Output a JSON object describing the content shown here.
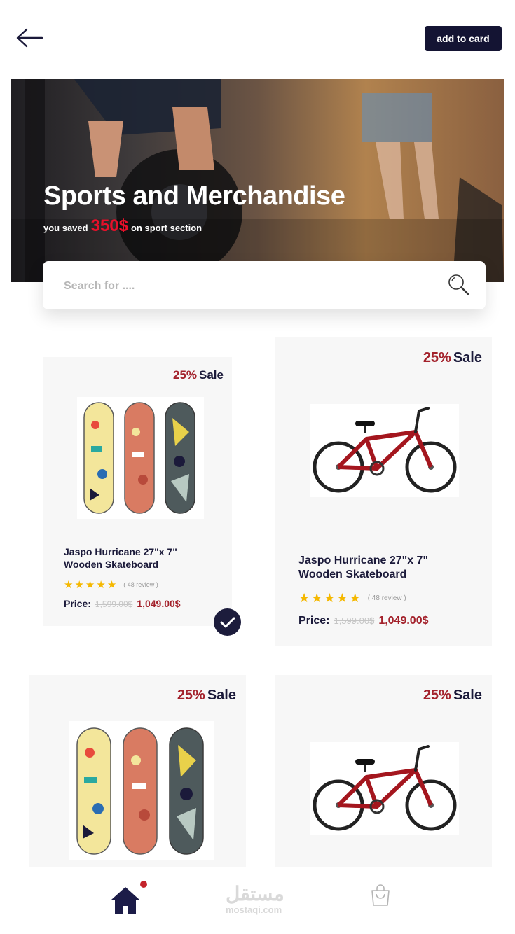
{
  "header": {
    "add_button_label": "add to card"
  },
  "hero": {
    "title": "Sports and Merchandise",
    "subtitle_prefix": "you saved",
    "saved_amount": "350$",
    "subtitle_suffix": "on sport section"
  },
  "search": {
    "placeholder": "Search for ...."
  },
  "products": [
    {
      "sale_pct": "25%",
      "sale_word": "Sale",
      "image": "skateboards",
      "name": "Jaspo Hurricane 27\"x 7\" Wooden Skateboard",
      "review_count": "( 48 review )",
      "rating": 5,
      "price_label": "Price:",
      "old_price": "1,599.00$",
      "new_price": "1,049.00$",
      "selected": true
    },
    {
      "sale_pct": "25%",
      "sale_word": "Sale",
      "image": "bicycle",
      "name": "Jaspo Hurricane 27\"x 7\" Wooden Skateboard",
      "review_count": "( 48 review )",
      "rating": 5,
      "price_label": "Price:",
      "old_price": "1,599.00$",
      "new_price": "1,049.00$",
      "selected": false
    },
    {
      "sale_pct": "25%",
      "sale_word": "Sale",
      "image": "skateboards"
    },
    {
      "sale_pct": "25%",
      "sale_word": "Sale",
      "image": "bicycle"
    }
  ],
  "nav": {
    "items": [
      "home-icon",
      "shopping-bag-icon"
    ],
    "notification": true
  },
  "watermark": {
    "arabic": "مستقل",
    "latin": "mostaqi.com"
  },
  "colors": {
    "primary_dark": "#141433",
    "accent_red": "#a3212b",
    "hero_amount": "#e8102a",
    "star": "#f5b800",
    "card_bg": "#f7f7f7"
  }
}
